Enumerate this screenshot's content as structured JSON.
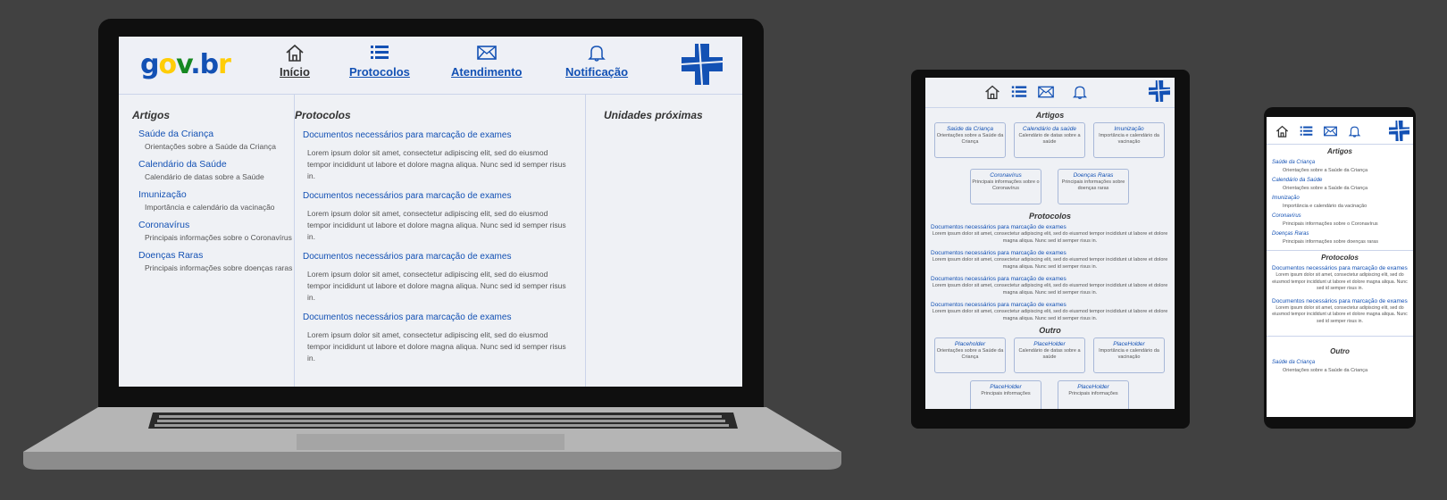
{
  "brand": {
    "logo_parts": [
      "g",
      "o",
      "v",
      ".",
      "b",
      "r"
    ],
    "logo_colors": [
      "#1351b4",
      "#ffcd07",
      "#168821",
      "#1351b4",
      "#1351b4",
      "#ffcd07"
    ],
    "accent": "#1351b4"
  },
  "nav": {
    "home": "Início",
    "protocols": "Protocolos",
    "support": "Atendimento",
    "notifications": "Notificação"
  },
  "artigos": {
    "title": "Artigos",
    "items": [
      {
        "title": "Saúde da Criança",
        "desc": "Orientações sobre a Saúde da Criança"
      },
      {
        "title": "Calendário da Saúde",
        "desc": "Calendário de datas sobre a Saúde"
      },
      {
        "title": "Imunização",
        "desc": "Importância e calendário da vacinação"
      },
      {
        "title": "Coronavírus",
        "desc": "Principais informações sobre o Coronavírus"
      },
      {
        "title": "Doenças Raras",
        "desc": "Principais informações sobre doenças raras"
      }
    ]
  },
  "protocolos": {
    "title": "Protocolos",
    "item_title": "Documentos necessários para marcação de exames",
    "item_text": "Lorem ipsum dolor sit amet, consectetur adipiscing elit, sed do eiusmod tempor incididunt ut labore et dolore magna aliqua. Nunc sed id semper risus in."
  },
  "unidades": {
    "title": "Unidades próximas"
  },
  "tablet": {
    "artigos_title": "Artigos",
    "cards": [
      {
        "title": "Saúde da Criança",
        "desc": "Orientações sobre a Saúde da Criança"
      },
      {
        "title": "Calendário da saúde",
        "desc": "Calendário de datas sobre a saúde"
      },
      {
        "title": "Imunização",
        "desc": "Importância e calendário da vacinação"
      },
      {
        "title": "Coronavírus",
        "desc": "Principais informações sobre o Coronavírus"
      },
      {
        "title": "Doenças Raras",
        "desc": "Principais informações sobre doenças raras"
      }
    ],
    "protocolos_title": "Protocolos",
    "outro_title": "Outro",
    "outro_cards": [
      {
        "title": "Placeholder",
        "desc": "Orientações sobre a Saúde da Criança"
      },
      {
        "title": "PlaceHolder",
        "desc": "Calendário de datas sobre a saúde"
      },
      {
        "title": "PlaceHolder",
        "desc": "Importância e calendário da vacinação"
      },
      {
        "title": "PlaceHolder",
        "desc": "Principais informações"
      },
      {
        "title": "PlaceHolder",
        "desc": "Principais informações"
      }
    ]
  },
  "phone": {
    "artigos_title": "Artigos",
    "items": [
      {
        "title": "Saúde da Criança",
        "desc": "Orientações sobre a Saúde da Criança"
      },
      {
        "title": "Calendário da Saúde",
        "desc": "Orientações sobre a Saúde da Criança"
      },
      {
        "title": "Imunização",
        "desc": "Importância e calendário da vacinação"
      },
      {
        "title": "Coronavírus",
        "desc": "Principais informações sobre o Coronavírus"
      },
      {
        "title": "Doenças Raras",
        "desc": "Principais informações sobre doenças raras"
      }
    ],
    "protocolos_title": "Protocolos",
    "outro_title": "Outro",
    "outro_item": {
      "title": "Saúde da Criança",
      "desc": "Orientações sobre a Saúde da Criança"
    }
  }
}
